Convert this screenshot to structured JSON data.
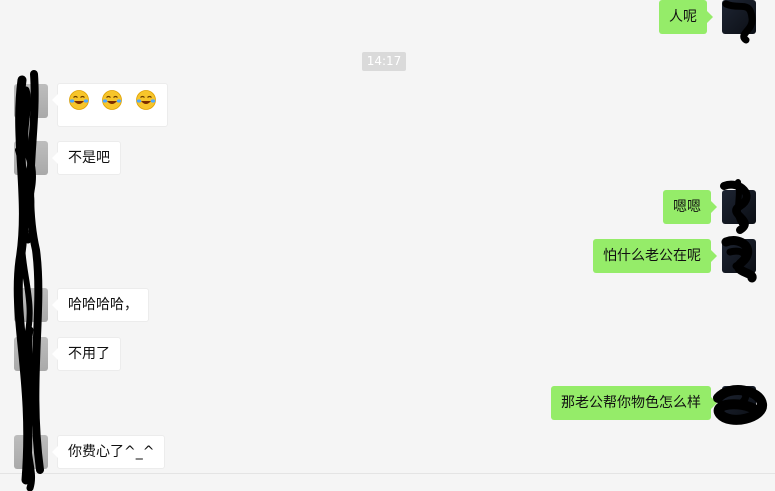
{
  "conversation": {
    "timestamp": "14:17",
    "messages": [
      {
        "side": "out",
        "text": "人呢"
      },
      {
        "side": "in",
        "type": "emoji",
        "emojis": [
          "face-with-tears-of-joy",
          "face-with-tears-of-joy",
          "face-with-tears-of-joy"
        ]
      },
      {
        "side": "in",
        "text": "不是吧"
      },
      {
        "side": "out",
        "text": "嗯嗯"
      },
      {
        "side": "out",
        "text": "怕什么老公在呢"
      },
      {
        "side": "in",
        "text": "哈哈哈哈，"
      },
      {
        "side": "in",
        "text": "不用了"
      },
      {
        "side": "out",
        "text": "那老公帮你物色怎么样"
      },
      {
        "side": "in",
        "text": "你费心了^_^"
      }
    ]
  },
  "colors": {
    "background": "#f5f5f5",
    "outgoing_bubble": "#95ec69",
    "incoming_bubble": "#ffffff",
    "timestamp_bg": "#dadada",
    "redaction_ink": "#000000"
  },
  "icons": {
    "emoji": "face-with-tears-of-joy-icon"
  }
}
